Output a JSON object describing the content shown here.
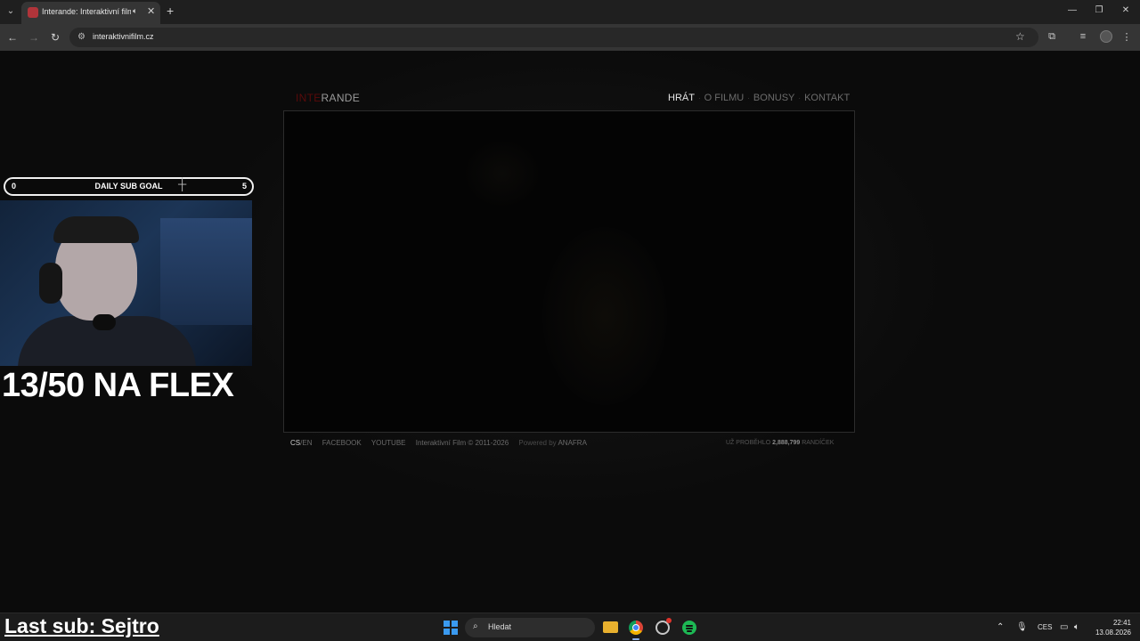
{
  "browser": {
    "tab_title": "Interande: Interaktivní film,",
    "url": "interaktivnifilm.cz",
    "icons": {
      "tab_list": "chevron-down-icon",
      "audio": "speaker-icon",
      "close_tab": "close-icon",
      "new_tab": "plus-icon",
      "back": "back-arrow-icon",
      "forward": "forward-arrow-icon",
      "reload": "reload-icon",
      "site_info": "tune-icon",
      "bookmark": "star-icon",
      "extensions": "puzzle-icon",
      "media": "media-controls-icon",
      "menu": "kebab-menu-icon"
    }
  },
  "site": {
    "logo_part1": "INTE",
    "logo_part2": "RANDE",
    "nav": [
      "HRÁT",
      "O FILMU",
      "BONUSY",
      "KONTAKT"
    ],
    "footer": {
      "lang_cs": "CS",
      "lang_sep": "/",
      "lang_en": "EN",
      "facebook": "FACEBOOK",
      "youtube": "YOUTUBE",
      "copyright": "Interaktivní Film © 2011-2026",
      "powered_by": "Powered by",
      "powered_brand": "ANAFRA",
      "counter_prefix": "UŽ PROBĚHLO",
      "counter_value": "2,888,799",
      "counter_suffix": "RANDÍČEK"
    }
  },
  "overlay": {
    "goal_min": "0",
    "goal_label": "DAILY SUB GOAL",
    "goal_max": "5",
    "flex_text": "13/50 NA FLEX",
    "last_sub": "Last sub: Sejtro"
  },
  "taskbar": {
    "search_placeholder": "Hledat",
    "language": "CES",
    "time": "22:41",
    "date": "13.08.2026"
  },
  "colors": {
    "logo_accent": "#5a0b0b",
    "start_blue": "#3a9af0",
    "spotify_green": "#1db954"
  }
}
